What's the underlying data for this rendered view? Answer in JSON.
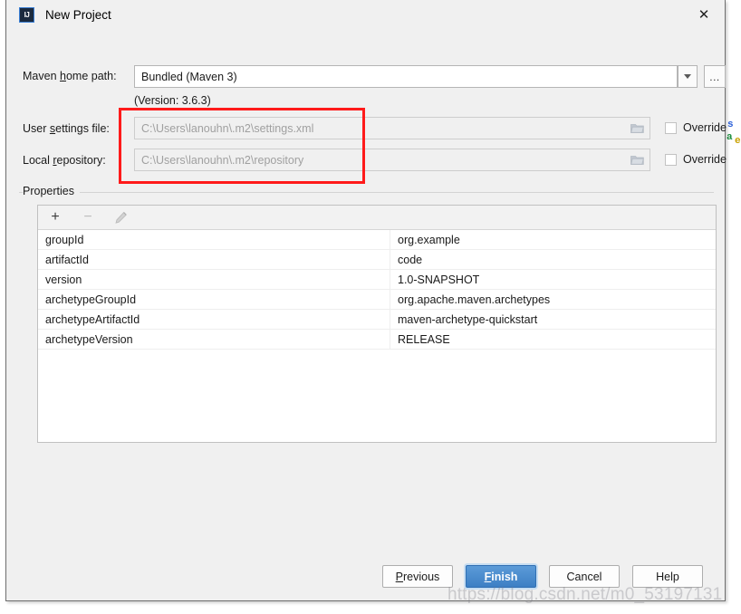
{
  "window": {
    "title": "New Project",
    "app_icon": "intellij-idea-icon",
    "icon_text": "IJ",
    "close_label": "✕"
  },
  "form": {
    "maven_home": {
      "label_prefix": "Maven ",
      "label_accel": "h",
      "label_suffix": "ome path:",
      "value": "Bundled (Maven 3)",
      "dropdown_icon": "chevron-down-icon",
      "browse_label": "...",
      "version_note": "(Version: 3.6.3)"
    },
    "user_settings": {
      "label_prefix": "User ",
      "label_accel": "s",
      "label_suffix": "ettings file:",
      "value": "C:\\Users\\lanouhn\\.m2\\settings.xml",
      "disabled": true,
      "browse_icon": "folder-icon",
      "override_label": "Override",
      "override_checked": false
    },
    "local_repository": {
      "label_prefix": "Local ",
      "label_accel": "r",
      "label_suffix": "epository:",
      "value": "C:\\Users\\lanouhn\\.m2\\repository",
      "disabled": true,
      "browse_icon": "folder-icon",
      "override_label": "Override",
      "override_checked": false
    }
  },
  "properties": {
    "group_title": "Properties",
    "toolbar": {
      "add_label": "+",
      "add_icon": "plus-icon",
      "remove_label": "−",
      "remove_icon": "minus-icon",
      "edit_icon": "pencil-icon"
    },
    "rows": [
      {
        "key": "groupId",
        "value": "org.example"
      },
      {
        "key": "artifactId",
        "value": "code"
      },
      {
        "key": "version",
        "value": "1.0-SNAPSHOT"
      },
      {
        "key": "archetypeGroupId",
        "value": "org.apache.maven.archetypes"
      },
      {
        "key": "archetypeArtifactId",
        "value": "maven-archetype-quickstart"
      },
      {
        "key": "archetypeVersion",
        "value": "RELEASE"
      }
    ]
  },
  "footer": {
    "previous": {
      "prefix": "",
      "accel": "P",
      "suffix": "revious"
    },
    "finish": {
      "prefix": "",
      "accel": "F",
      "suffix": "inish"
    },
    "cancel": {
      "label": "Cancel"
    },
    "help": {
      "label": "Help"
    }
  },
  "annotation": {
    "highlight_color": "#ff1a1a",
    "shape": "rectangle"
  },
  "watermark": {
    "text": "https://blog.csdn.net/m0_53197131"
  },
  "background_strip": {
    "fragments": [
      "a",
      "s",
      "e"
    ]
  }
}
